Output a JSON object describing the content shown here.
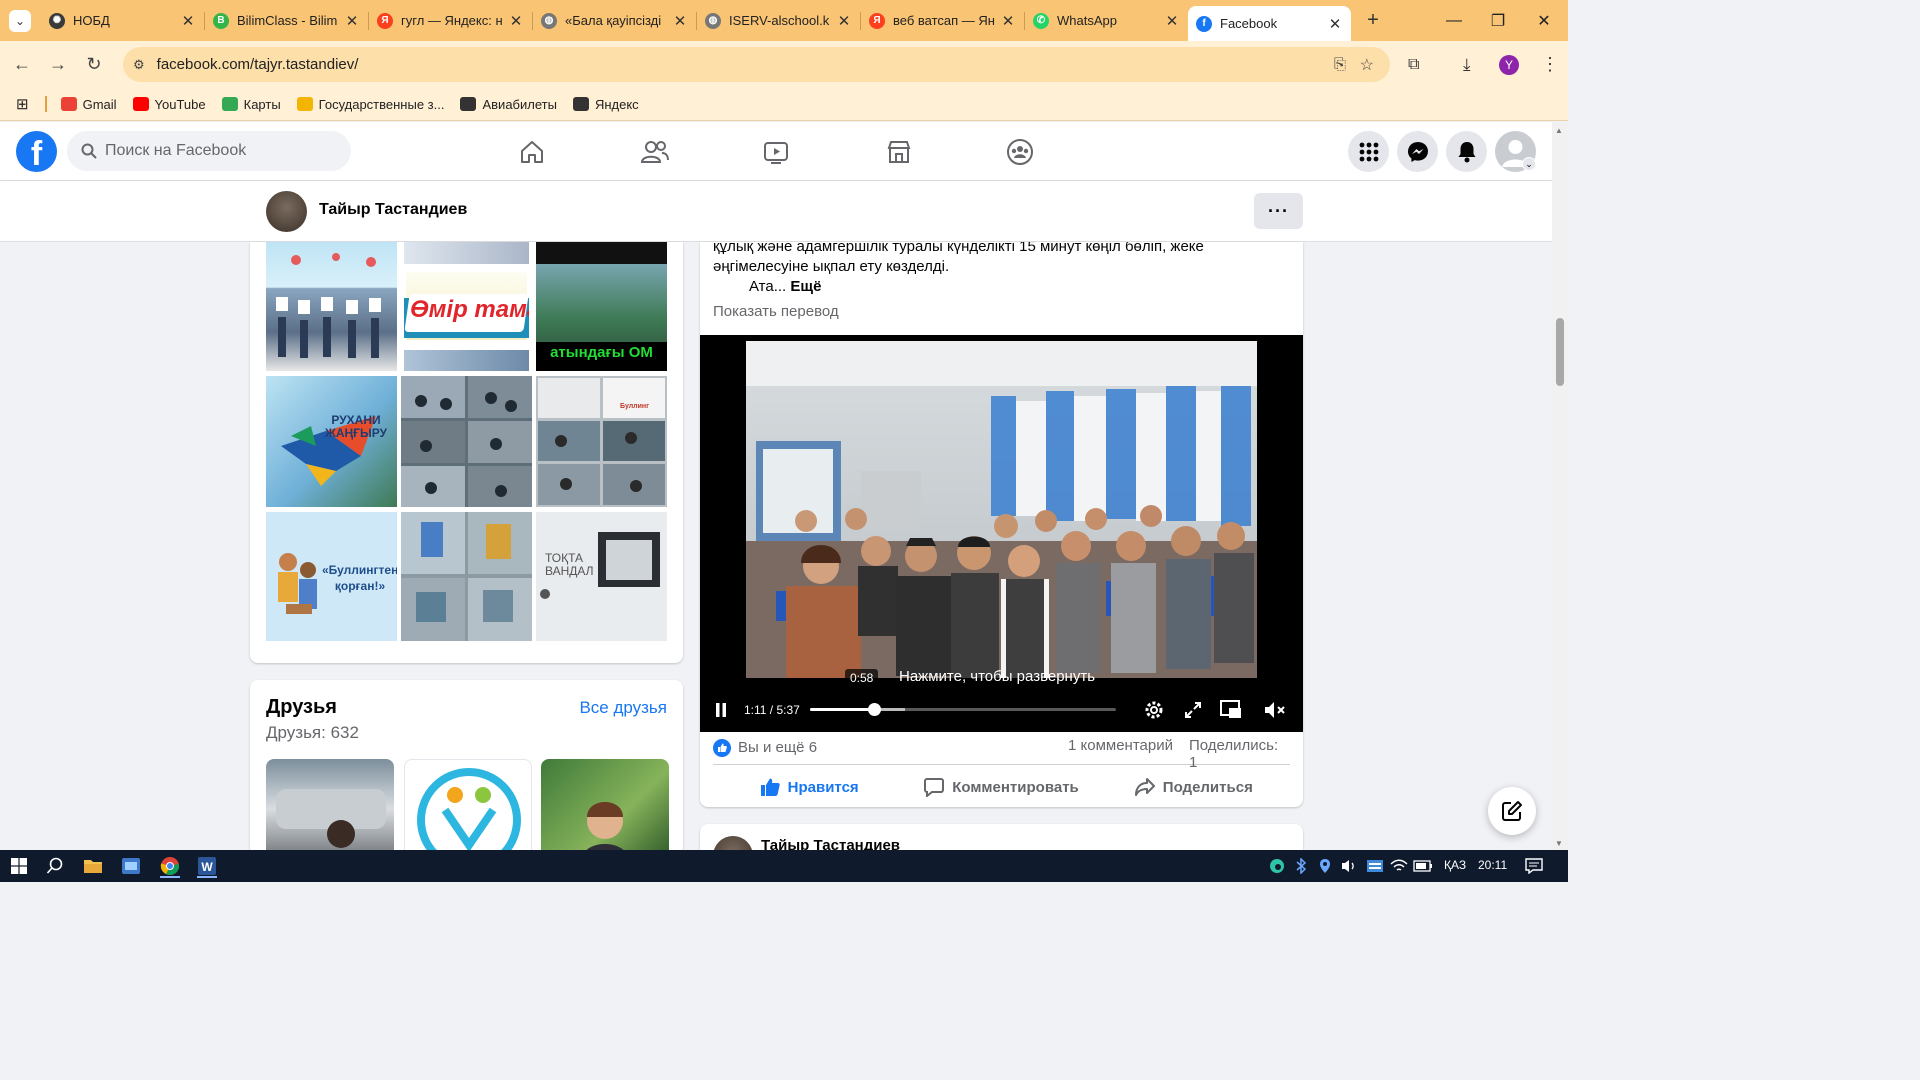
{
  "browser": {
    "tabs": [
      {
        "title": "НОБД",
        "fav_color": "#3a3a3a",
        "fav_glyph": "✺"
      },
      {
        "title": "BilimClass - Bilim",
        "fav_color": "#34b54a",
        "fav_glyph": "B"
      },
      {
        "title": "гугл — Яндекс: н",
        "fav_color": "#fc3f1d",
        "fav_glyph": "Я"
      },
      {
        "title": "«Бала қауіпсізді",
        "fav_color": "#777777",
        "fav_glyph": "◍"
      },
      {
        "title": "ISERV-alschool.k",
        "fav_color": "#777777",
        "fav_glyph": "◍"
      },
      {
        "title": "веб ватсап — Ян",
        "fav_color": "#fc3f1d",
        "fav_glyph": "Я"
      },
      {
        "title": "WhatsApp",
        "fav_color": "#25d366",
        "fav_glyph": "✆"
      },
      {
        "title": "Facebook",
        "fav_color": "#1877f2",
        "fav_glyph": "f"
      }
    ],
    "url": "facebook.com/tajyr.tastandiev/",
    "profile_initial": "Y",
    "bookmarks": [
      {
        "label": "Gmail",
        "color": "#ea4335"
      },
      {
        "label": "YouTube",
        "color": "#ff0000"
      },
      {
        "label": "Карты",
        "color": "#34a853"
      },
      {
        "label": "Государственные з...",
        "color": "#f4b400"
      },
      {
        "label": "Авиабилеты",
        "color": "#333333"
      },
      {
        "label": "Яндекс",
        "color": "#333333"
      }
    ]
  },
  "facebook": {
    "logo": "f",
    "search_placeholder": "Поиск на Facebook",
    "nav_icons": [
      "home-icon",
      "friends-icon",
      "video-icon",
      "marketplace-icon",
      "groups-icon"
    ],
    "right_icons": [
      "menu-grid-icon",
      "messenger-icon",
      "notifications-icon",
      "account-icon"
    ]
  },
  "profile": {
    "name": "Тайыр Тастандиев",
    "more": "···"
  },
  "photos": {
    "captions": [
      "Өмір тамаша!",
      "атындағы ОМ",
      "РУХАНИ ЖАҢҒЫРУ",
      "Буллинг",
      "«Буллингтен қорған!»",
      "ТОҚТА ВАНДАЛ"
    ]
  },
  "friends": {
    "title": "Друзья",
    "count": "Друзья: 632",
    "all_link": "Все друзья"
  },
  "post": {
    "text_line1": "құлық және адамгершілік туралы күнделікті 15 минут көңіл бөліп, жеке",
    "text_line2": "әңгімелесуіне ықпал ету көзделді.",
    "text_line3": "Ата...",
    "more": "Ещё",
    "translate": "Показать перевод",
    "video": {
      "hint": "Нажмите, чтобы развернуть",
      "tooltip_time": "0:58",
      "time": "1:11 / 5:37",
      "progress_fraction": 0.21,
      "buffered_fraction": 0.31
    },
    "reactions_text": "Вы и ещё 6",
    "comments": "1 комментарий",
    "shares": "Поделились: 1",
    "actions": {
      "like": "Нравится",
      "comment": "Комментировать",
      "share": "Поделиться"
    }
  },
  "next_post": {
    "author": "Тайыр Тастандиев"
  },
  "taskbar": {
    "lang": "ҚАЗ",
    "time": "20:11"
  }
}
